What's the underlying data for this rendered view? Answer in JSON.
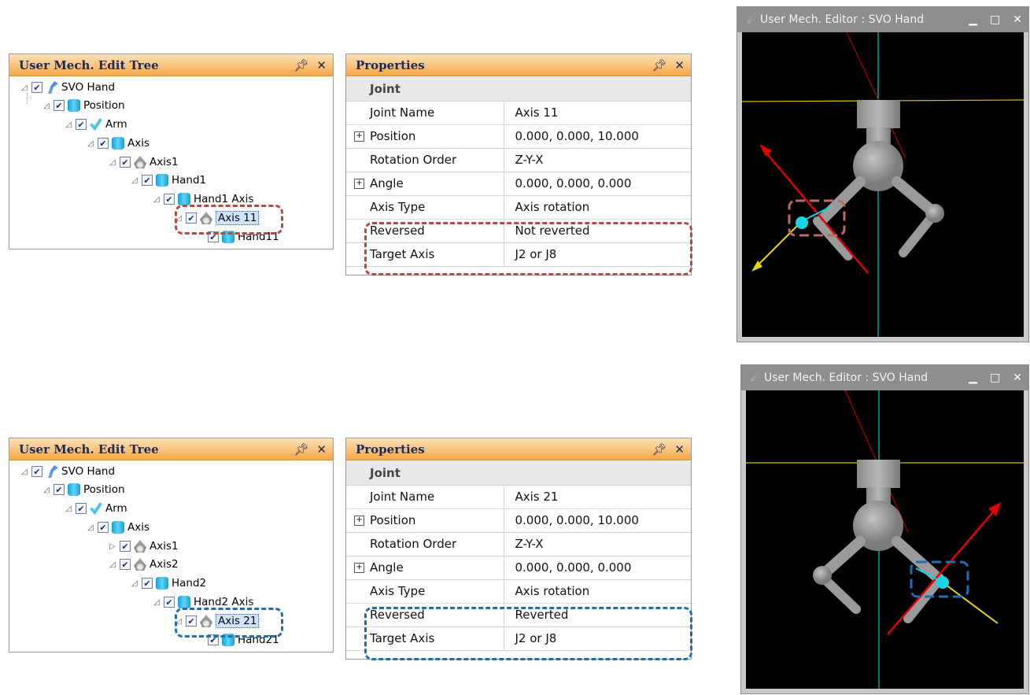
{
  "tree_panel": {
    "title": "User Mech. Edit Tree",
    "pin_icon": "pin-icon",
    "close_icon": "close-icon"
  },
  "properties_panel": {
    "title": "Properties"
  },
  "editor": {
    "title": "User Mech. Editor : SVO Hand"
  },
  "top": {
    "tree": [
      {
        "label": "SVO Hand",
        "icon": "hand-icon"
      },
      {
        "label": "Position",
        "icon": "cylinder-icon"
      },
      {
        "label": "Arm",
        "icon": "arm-icon"
      },
      {
        "label": "Axis",
        "icon": "cylinder-icon"
      },
      {
        "label": "Axis1",
        "icon": "joint-icon"
      },
      {
        "label": "Hand1",
        "icon": "cylinder-icon"
      },
      {
        "label": "Hand1 Axis",
        "icon": "cylinder-icon"
      },
      {
        "label": "Axis 11",
        "icon": "joint-icon"
      },
      {
        "label": "Hand11",
        "icon": "cylinder-icon"
      }
    ],
    "properties": {
      "category": "Joint",
      "rows": [
        {
          "key": "Joint Name",
          "value": "Axis 11"
        },
        {
          "key": "Position",
          "value": "0.000, 0.000, 10.000"
        },
        {
          "key": "Rotation Order",
          "value": "Z-Y-X"
        },
        {
          "key": "Angle",
          "value": "0.000, 0.000, 0.000"
        },
        {
          "key": "Axis Type",
          "value": "Axis rotation"
        },
        {
          "key": "Reversed",
          "value": "Not reverted"
        },
        {
          "key": "Target Axis",
          "value": "J2 or J8"
        }
      ]
    }
  },
  "bottom": {
    "tree": [
      {
        "label": "SVO Hand",
        "icon": "hand-icon"
      },
      {
        "label": "Position",
        "icon": "cylinder-icon"
      },
      {
        "label": "Arm",
        "icon": "arm-icon"
      },
      {
        "label": "Axis",
        "icon": "cylinder-icon"
      },
      {
        "label": "Axis1",
        "icon": "joint-icon"
      },
      {
        "label": "Axis2",
        "icon": "joint-icon"
      },
      {
        "label": "Hand2",
        "icon": "cylinder-icon"
      },
      {
        "label": "Hand2 Axis",
        "icon": "cylinder-icon"
      },
      {
        "label": "Axis 21",
        "icon": "joint-icon"
      },
      {
        "label": "Hand21",
        "icon": "cylinder-icon"
      }
    ],
    "properties": {
      "category": "Joint",
      "rows": [
        {
          "key": "Joint Name",
          "value": "Axis 21"
        },
        {
          "key": "Position",
          "value": "0.000, 0.000, 10.000"
        },
        {
          "key": "Rotation Order",
          "value": "Z-Y-X"
        },
        {
          "key": "Angle",
          "value": "0.000, 0.000, 0.000"
        },
        {
          "key": "Axis Type",
          "value": "Axis rotation"
        },
        {
          "key": "Reversed",
          "value": "Reverted"
        },
        {
          "key": "Target Axis",
          "value": "J2 or J8"
        }
      ]
    }
  },
  "colors": {
    "panel_header": "#f4a64a",
    "highlight_red": "#b84a44",
    "highlight_blue": "#1f6eb0",
    "selection": "#cfe3fa"
  }
}
